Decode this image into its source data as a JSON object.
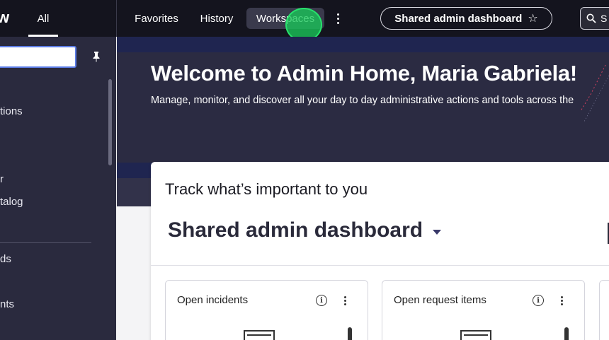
{
  "topnav": {
    "logo_text": "w",
    "all_label": "All",
    "favorites_label": "Favorites",
    "history_label": "History",
    "workspaces_label": "Workspaces",
    "shared_dashboard_label": "Shared admin dashboard",
    "search_label": "S"
  },
  "sidebar": {
    "filter_value": "",
    "items": [
      {
        "label": "tions"
      },
      {
        "label": "r"
      },
      {
        "label": "talog"
      },
      {
        "label": "ds"
      },
      {
        "label": "nts"
      }
    ]
  },
  "hero": {
    "title": "Welcome to Admin Home, Maria Gabriela!",
    "subtitle": "Manage, monitor, and discover all your day to day administrative actions and tools across the"
  },
  "dashboard": {
    "track_title": "Track what’s important to you",
    "selected_dashboard": "Shared admin dashboard",
    "widgets": [
      {
        "title": "Open incidents"
      },
      {
        "title": "Open request items"
      }
    ]
  }
}
